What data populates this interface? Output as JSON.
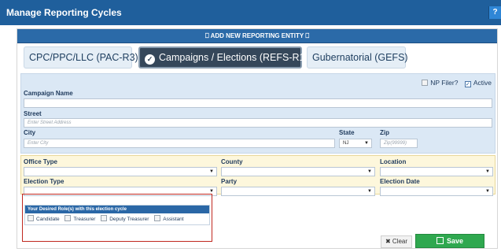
{
  "header": {
    "title": "Manage Reporting Cycles",
    "help_icon": "?"
  },
  "add_bar": {
    "label": "ADD NEW REPORTING ENTITY",
    "icon": "bookmark-icon"
  },
  "tabs": [
    {
      "label": "CPC/PPC/LLC (PAC-R3)",
      "active": false
    },
    {
      "label": "Campaigns / Elections (REFS-R1)",
      "active": true
    },
    {
      "label": "Gubernatorial (GEFS)",
      "active": false
    }
  ],
  "flags": {
    "np_filer": "NP Filer?",
    "active": "Active",
    "active_checked": true,
    "np_checked": false
  },
  "campaign": {
    "name_label": "Campaign Name",
    "street_label": "Street",
    "street_placeholder": "Enter Street Address",
    "city_label": "City",
    "city_placeholder": "Enter City",
    "state_label": "State",
    "state_value": "NJ",
    "zip_label": "Zip",
    "zip_placeholder": "Zip(99999)"
  },
  "election": {
    "office_type_label": "Office Type",
    "county_label": "County",
    "location_label": "Location",
    "election_type_label": "Election Type",
    "party_label": "Party",
    "election_date_label": "Election Date"
  },
  "roles": {
    "header": "Your Desired Role(s) with this election cycle",
    "items": [
      "Candidate",
      "Treasurer",
      "Deputy Treasurer",
      "Assistant"
    ]
  },
  "actions": {
    "clear_label": "Clear",
    "save_label": "Save"
  },
  "colors": {
    "primary": "#1f5f9c",
    "save": "#2fa84f",
    "highlight": "#c0281f"
  }
}
